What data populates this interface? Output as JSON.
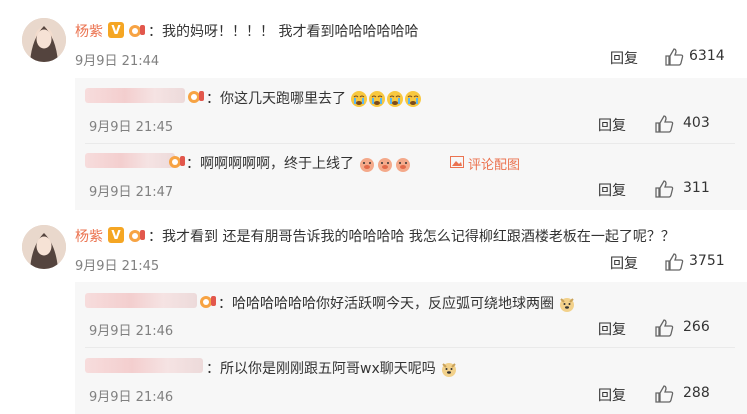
{
  "comments": [
    {
      "user": "杨紫",
      "text": "我的妈呀！！！！ 我才看到哈哈哈哈哈哈",
      "time": "9月9日 21:44",
      "reply_label": "回复",
      "likes": "6314"
    },
    {
      "user": "杨紫",
      "text": "我才看到 还是有朋哥告诉我的哈哈哈哈 我怎么记得柳红跟酒楼老板在一起了呢？？",
      "time": "9月9日 21:45",
      "reply_label": "回复",
      "likes": "3751"
    }
  ],
  "replies": [
    {
      "text": "你这几天跑哪里去了",
      "time": "9月9日 21:45",
      "reply_label": "回复",
      "likes": "403",
      "emoji": "crying-emoji"
    },
    {
      "text": "啊啊啊啊啊，终于上线了",
      "time": "9月9日 21:47",
      "reply_label": "回复",
      "likes": "311",
      "emoji": "pig-emoji",
      "image_link": "评论配图"
    },
    {
      "text": "哈哈哈哈哈哈你好活跃啊今天，反应弧可绕地球两圈",
      "time": "9月9日 21:46",
      "reply_label": "回复",
      "likes": "266",
      "emoji": "doge-emoji"
    },
    {
      "text": "所以你是刚刚跟五阿哥wx聊天呢吗",
      "time": "9月9日 21:46",
      "reply_label": "回复",
      "likes": "288",
      "emoji": "doge-emoji"
    }
  ],
  "icons": {
    "verified": "V",
    "like": "thumbs-up-icon",
    "image": "picture-icon"
  },
  "colors": {
    "username": "#eb7350",
    "verified": "#f5a623",
    "reply_bg": "#f7f7f7"
  }
}
